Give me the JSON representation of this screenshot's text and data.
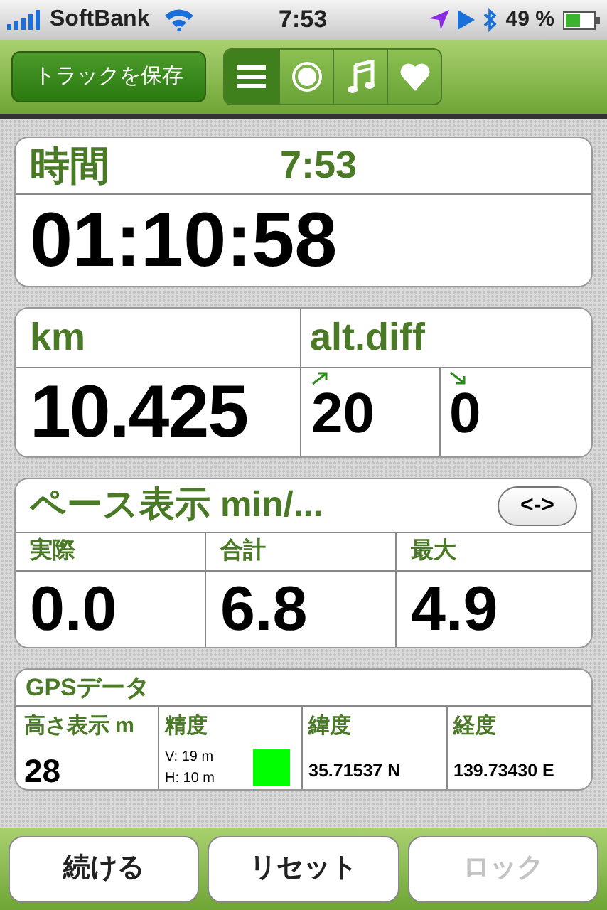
{
  "status_bar": {
    "carrier": "SoftBank",
    "time": "7:53",
    "battery": "49 %"
  },
  "toolbar": {
    "save_button": "トラックを保存",
    "segments": [
      {
        "kind": "list",
        "selected": true
      },
      {
        "kind": "record",
        "selected": false
      },
      {
        "kind": "music",
        "selected": false
      },
      {
        "kind": "heart",
        "selected": false
      }
    ]
  },
  "time_card": {
    "label": "時間",
    "clock": "7:53",
    "value": "01:10:58"
  },
  "distance_card": {
    "label": "km",
    "value": "10.425",
    "alt_label": "alt.diff",
    "ascent": "20",
    "descent": "0"
  },
  "pace_card": {
    "label": "ペース表示 min/...",
    "toggle": "<->",
    "columns": [
      {
        "label": "実際",
        "value": "0.0"
      },
      {
        "label": "合計",
        "value": "6.8"
      },
      {
        "label": "最大",
        "value": "4.9"
      }
    ]
  },
  "gps_card": {
    "title": "GPSデータ",
    "altitude_label": "高さ表示 m",
    "altitude": "28",
    "accuracy_label": "精度",
    "accuracy": {
      "vertical": "V: 19 m",
      "horizontal": "H: 10 m",
      "color": "#00ff00"
    },
    "latitude_label": "緯度",
    "latitude": "35.71537 N",
    "longitude_label": "経度",
    "longitude": "139.73430 E"
  },
  "buttons": [
    {
      "label": "続ける",
      "disabled": false
    },
    {
      "label": "リセット",
      "disabled": false
    },
    {
      "label": "ロック",
      "disabled": true
    }
  ]
}
